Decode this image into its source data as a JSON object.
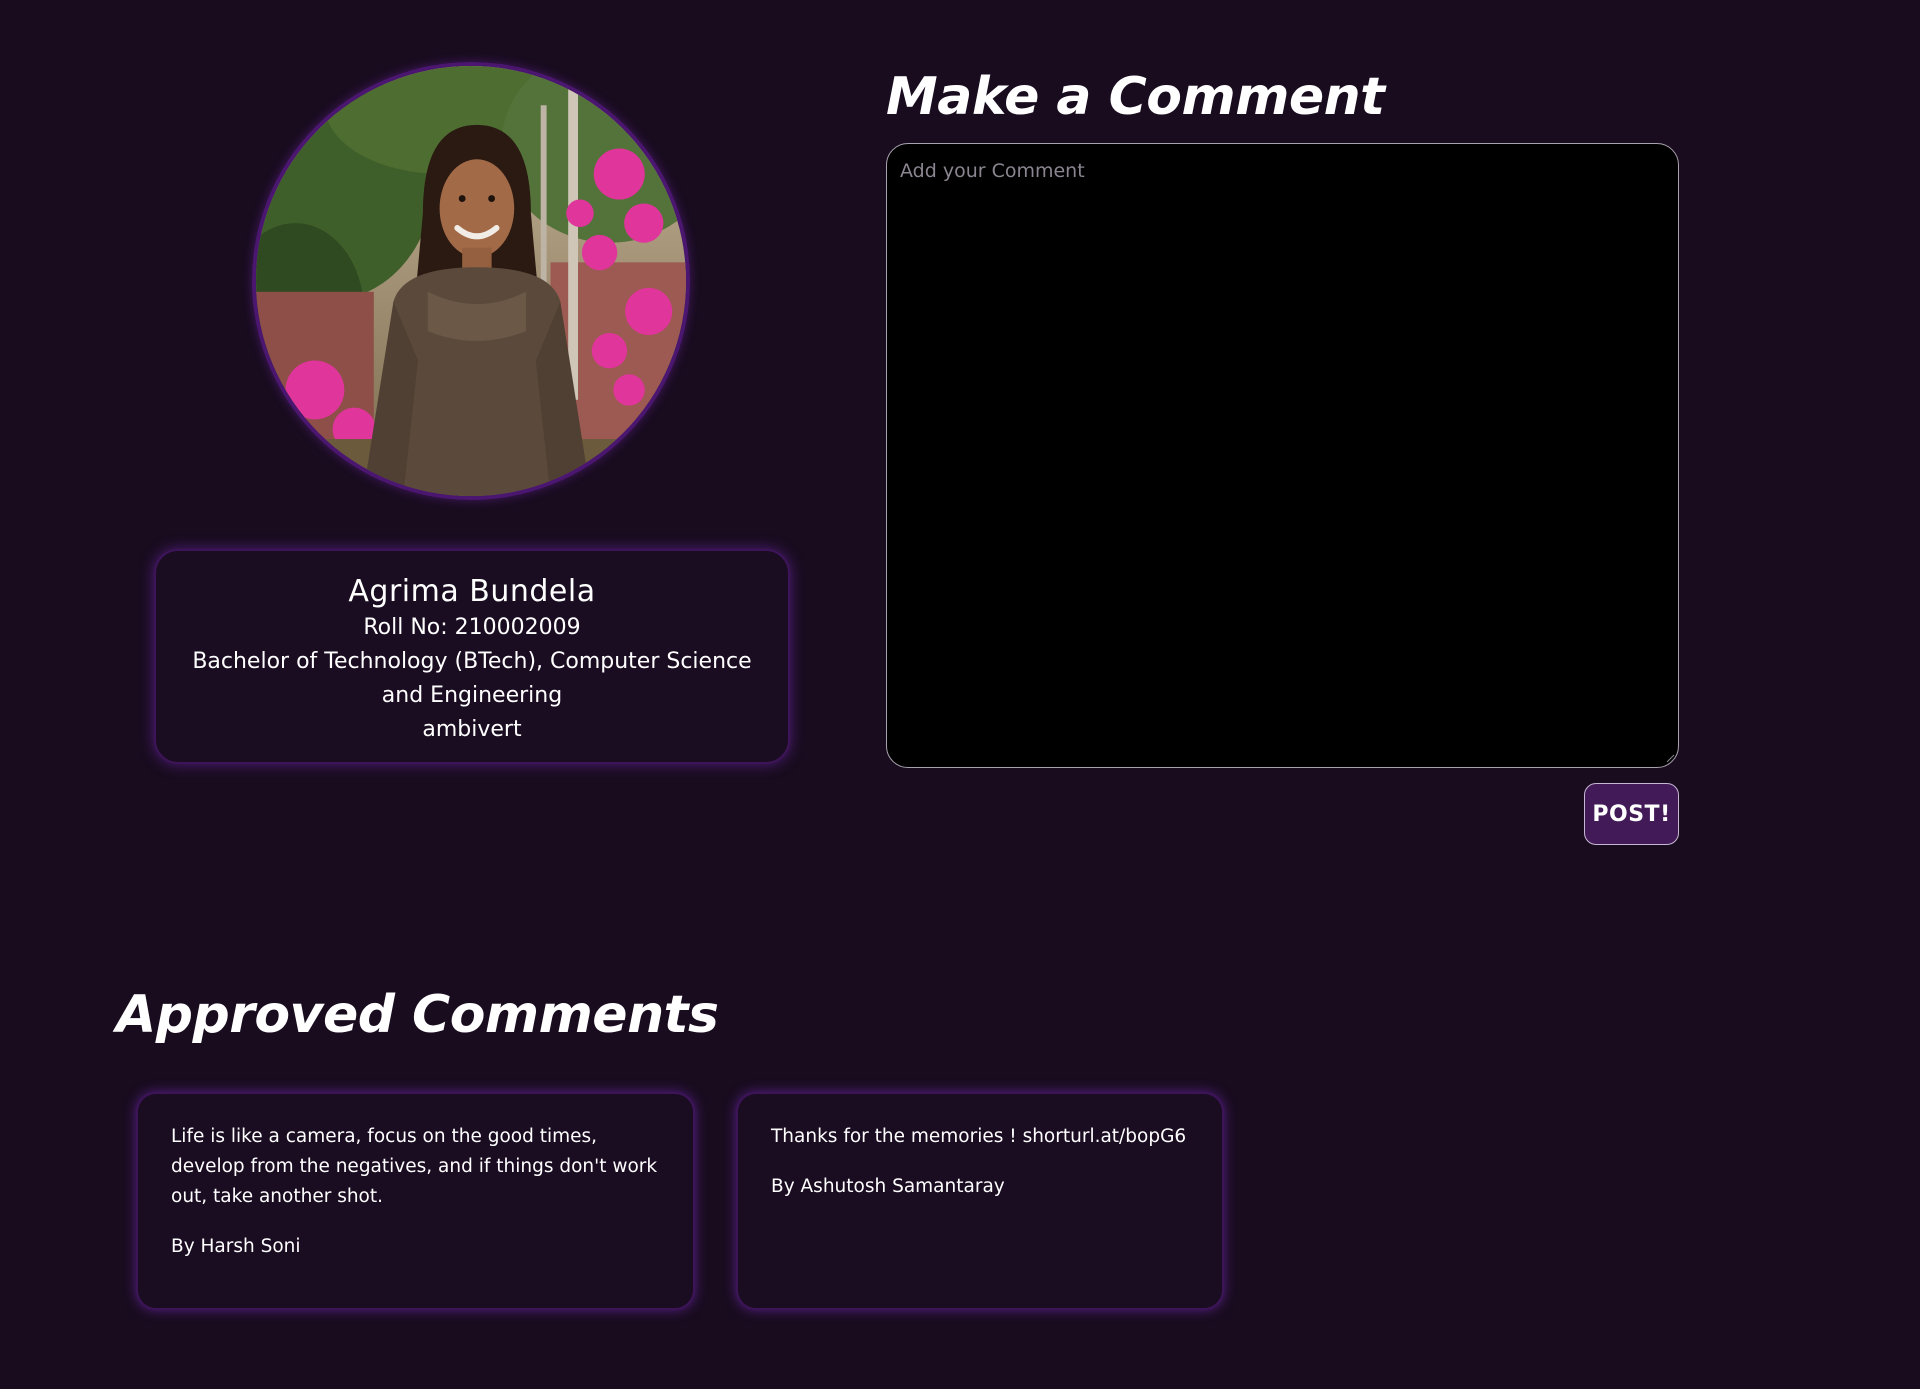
{
  "profile": {
    "photo_icon": "person-portrait-photo",
    "name": "Agrima Bundela",
    "roll": "Roll No: 210002009",
    "degree": "Bachelor of Technology (BTech), Computer Science and Engineering",
    "trait": "ambivert"
  },
  "comment_form": {
    "title": "Make a Comment",
    "placeholder": "Add your Comment",
    "value": "",
    "post_label": "POST!"
  },
  "approved": {
    "title": "Approved Comments",
    "comments": [
      {
        "text": "Life is like a camera, focus on the good times, develop from the negatives, and if things don't work out, take another shot.",
        "author": "By Harsh Soni"
      },
      {
        "text": "Thanks for the memories ! shorturl.at/bopG6",
        "author": "By Ashutosh Samantaray"
      }
    ]
  },
  "colors": {
    "background": "#190c1f",
    "card_border": "#3d1458",
    "card_glow": "#7d2dc8",
    "button_bg": "#421a57",
    "input_bg": "#000000"
  }
}
